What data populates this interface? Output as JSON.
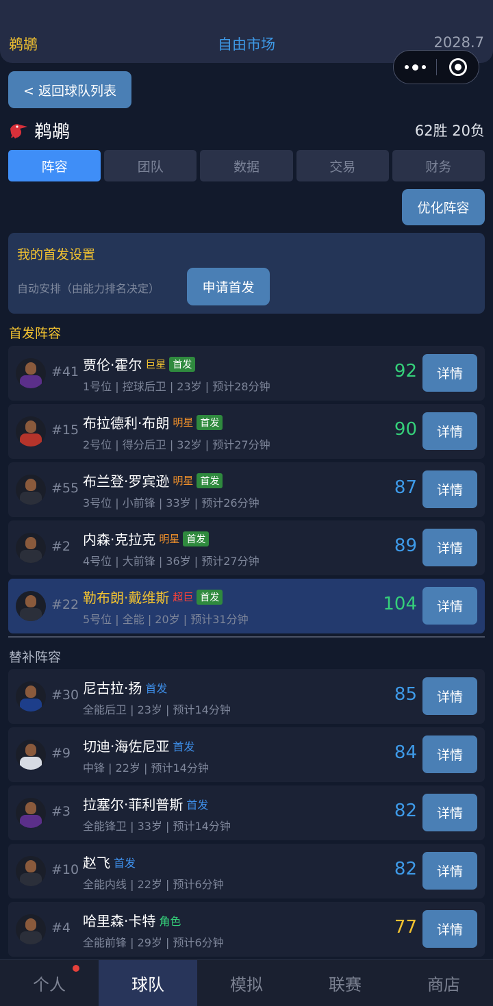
{
  "header": {
    "team": "鹈鹕",
    "title": "自由市场",
    "date": "2028.7"
  },
  "back_label": "< 返回球队列表",
  "team": {
    "name": "鹈鹕",
    "record": "62胜 20负"
  },
  "tabs": [
    {
      "label": "阵容",
      "active": true
    },
    {
      "label": "团队",
      "active": false
    },
    {
      "label": "数据",
      "active": false
    },
    {
      "label": "交易",
      "active": false
    },
    {
      "label": "财务",
      "active": false
    }
  ],
  "optimize_label": "优化阵容",
  "settings": {
    "title": "我的首发设置",
    "desc": "自动安排（由能力排名决定）",
    "apply_label": "申请首发"
  },
  "starters_title": "首发阵容",
  "bench_title": "替补阵容",
  "detail_label": "详情",
  "colors": {
    "gold": "#f2c230",
    "blue": "#3e9ae8",
    "green": "#35d07a",
    "orange": "#f0902a",
    "red": "#f0413b",
    "yellow": "#f2c230"
  },
  "starters": [
    {
      "number": "#41",
      "name": "贾伦·霍尔",
      "tag": "巨星",
      "tag_color": "#f2c230",
      "badge": "首发",
      "info": "1号位 | 控球后卫 | 23岁 | 预计28分钟",
      "rating": "92",
      "rating_color": "#35d07a",
      "jersey_color": "#5b2f8a"
    },
    {
      "number": "#15",
      "name": "布拉德利·布朗",
      "tag": "明星",
      "tag_color": "#f0902a",
      "badge": "首发",
      "info": "2号位 | 得分后卫 | 32岁 | 预计27分钟",
      "rating": "90",
      "rating_color": "#35d07a",
      "jersey_color": "#b5342b"
    },
    {
      "number": "#55",
      "name": "布兰登·罗宾逊",
      "tag": "明星",
      "tag_color": "#f0902a",
      "badge": "首发",
      "info": "3号位 | 小前锋 | 33岁 | 预计26分钟",
      "rating": "87",
      "rating_color": "#3e9ae8",
      "jersey_color": "#2b2f3a"
    },
    {
      "number": "#2",
      "name": "内森·克拉克",
      "tag": "明星",
      "tag_color": "#f0902a",
      "badge": "首发",
      "info": "4号位 | 大前锋 | 36岁 | 预计27分钟",
      "rating": "89",
      "rating_color": "#3e9ae8",
      "jersey_color": "#2b2f3a"
    },
    {
      "number": "#22",
      "name": "勒布朗·戴维斯",
      "tag": "超巨",
      "tag_color": "#f0413b",
      "badge": "首发",
      "info": "5号位 | 全能 | 20岁 | 预计31分钟",
      "rating": "104",
      "rating_color": "#35d07a",
      "jersey_color": "#2b2f3a",
      "highlight": true
    }
  ],
  "bench": [
    {
      "number": "#30",
      "name": "尼古拉·扬",
      "tag": "首发",
      "tag_color": "#3e8ee8",
      "info": "全能后卫 | 23岁 | 预计14分钟",
      "rating": "85",
      "rating_color": "#3e9ae8",
      "jersey_color": "#1d3e8a"
    },
    {
      "number": "#9",
      "name": "切迪·海佐尼亚",
      "tag": "首发",
      "tag_color": "#3e8ee8",
      "info": "中锋 | 22岁 | 预计14分钟",
      "rating": "84",
      "rating_color": "#3e9ae8",
      "jersey_color": "#d7dbe3"
    },
    {
      "number": "#3",
      "name": "拉塞尔·菲利普斯",
      "tag": "首发",
      "tag_color": "#3e8ee8",
      "info": "全能锋卫 | 33岁 | 预计14分钟",
      "rating": "82",
      "rating_color": "#3e9ae8",
      "jersey_color": "#5b2f8a"
    },
    {
      "number": "#10",
      "name": "赵飞",
      "tag": "首发",
      "tag_color": "#3e8ee8",
      "info": "全能内线 | 22岁 | 预计6分钟",
      "rating": "82",
      "rating_color": "#3e9ae8",
      "jersey_color": "#2b2f3a"
    },
    {
      "number": "#4",
      "name": "哈里森·卡特",
      "tag": "角色",
      "tag_color": "#35d07a",
      "info": "全能前锋 | 29岁 | 预计6分钟",
      "rating": "77",
      "rating_color": "#f2c230",
      "jersey_color": "#2b2f3a"
    }
  ],
  "tabbar": [
    {
      "label": "个人",
      "active": false,
      "dot": true
    },
    {
      "label": "球队",
      "active": true,
      "dot": false
    },
    {
      "label": "模拟",
      "active": false,
      "dot": false
    },
    {
      "label": "联赛",
      "active": false,
      "dot": false
    },
    {
      "label": "商店",
      "active": false,
      "dot": false
    }
  ]
}
